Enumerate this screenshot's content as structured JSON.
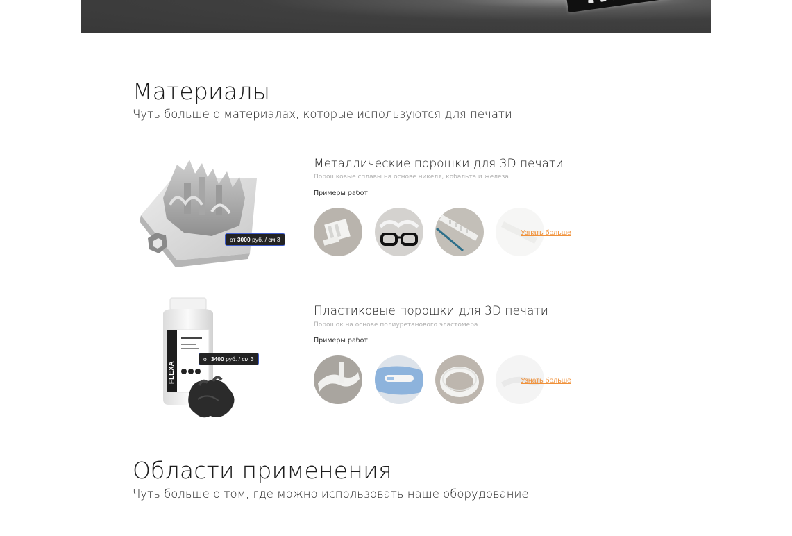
{
  "materials_section": {
    "title": "Материалы",
    "subtitle": "Чуть больше о материалах, которые используются для печати"
  },
  "materials": [
    {
      "title": "Металлические порошки для 3D печати",
      "description": "Порошковые сплавы на основе никеля, кобальта и железа",
      "examples_label": "Примеры работ",
      "price_prefix": "от",
      "price_value": "3000",
      "price_suffix": "руб. / см 3",
      "more_link": "Узнать больше"
    },
    {
      "title": "Пластиковые порошки для 3D печати",
      "description": "Порошок на основе полиуретанового эластомера",
      "examples_label": "Примеры работ",
      "price_prefix": "от",
      "price_value": "3400",
      "price_suffix": "руб. / см 3",
      "more_link": "Узнать больше"
    }
  ],
  "applications_section": {
    "title": "Области применения",
    "subtitle": "Чуть больше о том, где можно использовать наше оборудование"
  },
  "colors": {
    "accent": "#f0913a",
    "hero_bg": "#3a3a3a",
    "price_tag_bg": "#232323"
  }
}
